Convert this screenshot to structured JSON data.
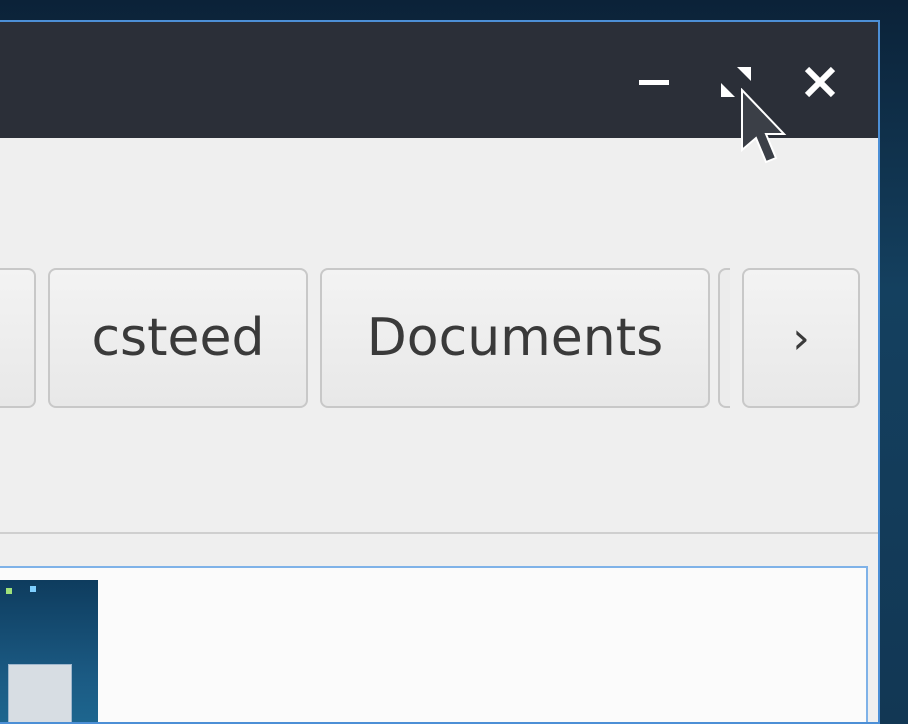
{
  "window": {
    "controls": {
      "minimize_icon": "minimize-icon",
      "maximize_icon": "restore-icon",
      "close_icon": "close-icon"
    }
  },
  "pathbar": {
    "items": [
      {
        "label": ""
      },
      {
        "label": "csteed"
      },
      {
        "label": "Documents"
      }
    ],
    "next_label": "›"
  },
  "colors": {
    "titlebar": "#2b2f38",
    "window_bg": "#efefef",
    "focus_border": "#4c8fd6"
  }
}
